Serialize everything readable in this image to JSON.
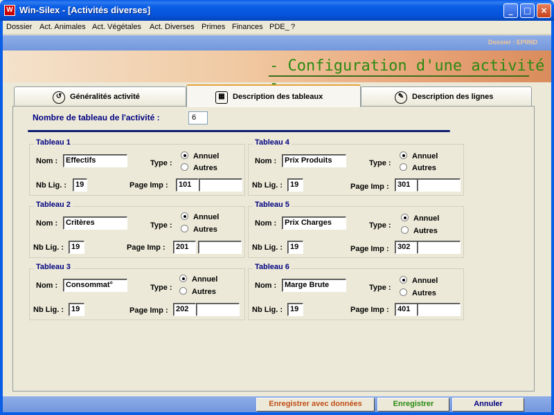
{
  "window": {
    "title": "Win-Silex - [Activités diverses]",
    "app_icon_text": "W",
    "controls": {
      "minimize": "_",
      "maximize": "□",
      "close": "×"
    }
  },
  "menu": [
    "Dossier",
    "Act. Animales",
    "Act. Végétales",
    "Act. Diverses",
    "Primes",
    "Finances",
    "PDE_",
    "?"
  ],
  "dossier_label": "Dossier : EPIIND",
  "banner_title": "- Configuration d'une activité -",
  "tabs": [
    {
      "label": "Généralités activité",
      "icon": "clock-icon",
      "active": false
    },
    {
      "label": "Description des tableaux",
      "icon": "table-icon",
      "active": true
    },
    {
      "label": "Description des lignes",
      "icon": "wrench-icon",
      "active": false
    }
  ],
  "nb_tableaux": {
    "label": "Nombre de tableau de l'activité  :",
    "value": "6"
  },
  "labels": {
    "nom": "Nom :",
    "type": "Type :",
    "nb_lig": "Nb Lig. :",
    "page_imp": "Page Imp :",
    "annuel": "Annuel",
    "autres": "Autres"
  },
  "tableaux": [
    {
      "title": "Tableau 1",
      "nom": "Effectifs",
      "nb_lig": "19",
      "page_imp": "101",
      "page_imp_extra": "",
      "type": "Annuel"
    },
    {
      "title": "Tableau 2",
      "nom": "Critères",
      "nb_lig": "19",
      "page_imp": "201",
      "page_imp_extra": "",
      "type": "Annuel"
    },
    {
      "title": "Tableau 3",
      "nom": "Consommat°",
      "nb_lig": "19",
      "page_imp": "202",
      "page_imp_extra": "",
      "type": "Annuel"
    },
    {
      "title": "Tableau 4",
      "nom": "Prix Produits",
      "nb_lig": "19",
      "page_imp": "301",
      "page_imp_extra": "",
      "type": "Annuel"
    },
    {
      "title": "Tableau 5",
      "nom": "Prix Charges",
      "nb_lig": "19",
      "page_imp": "302",
      "page_imp_extra": "",
      "type": "Annuel"
    },
    {
      "title": "Tableau 6",
      "nom": "Marge Brute",
      "nb_lig": "19",
      "page_imp": "401",
      "page_imp_extra": "",
      "type": "Annuel"
    }
  ],
  "buttons": {
    "save_with_data": "Enregistrer avec données",
    "save": "Enregistrer",
    "cancel": "Annuler"
  },
  "colors": {
    "title_bar": "#0b5fe6",
    "banner_title": "#2a8a12",
    "group_title": "#000080",
    "btn_save_with_data": "#c0501a",
    "btn_save": "#2a8a12",
    "btn_cancel": "#000080"
  }
}
